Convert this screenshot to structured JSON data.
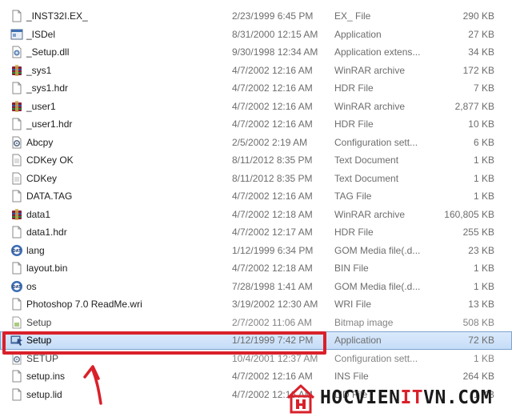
{
  "files": [
    {
      "name": "_INST32I.EX_",
      "date": "2/23/1999 6:45 PM",
      "type": "EX_ File",
      "size": "290 KB",
      "icon": "blank-file-icon"
    },
    {
      "name": "_ISDel",
      "date": "8/31/2000 12:15 AM",
      "type": "Application",
      "size": "27 KB",
      "icon": "application-icon"
    },
    {
      "name": "_Setup.dll",
      "date": "9/30/1998 12:34 AM",
      "type": "Application extens...",
      "size": "34 KB",
      "icon": "dll-icon"
    },
    {
      "name": "_sys1",
      "date": "4/7/2002 12:16 AM",
      "type": "WinRAR archive",
      "size": "172 KB",
      "icon": "winrar-icon"
    },
    {
      "name": "_sys1.hdr",
      "date": "4/7/2002 12:16 AM",
      "type": "HDR File",
      "size": "7 KB",
      "icon": "blank-file-icon"
    },
    {
      "name": "_user1",
      "date": "4/7/2002 12:16 AM",
      "type": "WinRAR archive",
      "size": "2,877 KB",
      "icon": "winrar-icon"
    },
    {
      "name": "_user1.hdr",
      "date": "4/7/2002 12:16 AM",
      "type": "HDR File",
      "size": "10 KB",
      "icon": "blank-file-icon"
    },
    {
      "name": "Abcpy",
      "date": "2/5/2002 2:19 AM",
      "type": "Configuration sett...",
      "size": "6 KB",
      "icon": "config-icon"
    },
    {
      "name": "CDKey OK",
      "date": "8/11/2012 8:35 PM",
      "type": "Text Document",
      "size": "1 KB",
      "icon": "text-file-icon"
    },
    {
      "name": "CDKey",
      "date": "8/11/2012 8:35 PM",
      "type": "Text Document",
      "size": "1 KB",
      "icon": "text-file-icon"
    },
    {
      "name": "DATA.TAG",
      "date": "4/7/2002 12:16 AM",
      "type": "TAG File",
      "size": "1 KB",
      "icon": "blank-file-icon"
    },
    {
      "name": "data1",
      "date": "4/7/2002 12:18 AM",
      "type": "WinRAR archive",
      "size": "160,805 KB",
      "icon": "winrar-icon"
    },
    {
      "name": "data1.hdr",
      "date": "4/7/2002 12:17 AM",
      "type": "HDR File",
      "size": "255 KB",
      "icon": "blank-file-icon"
    },
    {
      "name": "lang",
      "date": "1/12/1999 6:34 PM",
      "type": "GOM Media file(.d...",
      "size": "23 KB",
      "icon": "gom-media-icon"
    },
    {
      "name": "layout.bin",
      "date": "4/7/2002 12:18 AM",
      "type": "BIN File",
      "size": "1 KB",
      "icon": "blank-file-icon"
    },
    {
      "name": "os",
      "date": "7/28/1998 1:41 AM",
      "type": "GOM Media file(.d...",
      "size": "1 KB",
      "icon": "gom-media-icon"
    },
    {
      "name": "Photoshop 7.0 ReadMe.wri",
      "date": "3/19/2002 12:30 AM",
      "type": "WRI File",
      "size": "13 KB",
      "icon": "blank-file-icon"
    },
    {
      "name": "Setup",
      "date": "2/7/2002 11:06 AM",
      "type": "Bitmap image",
      "size": "508 KB",
      "icon": "bitmap-icon",
      "partial": true
    },
    {
      "name": "Setup",
      "date": "1/12/1999 7:42 PM",
      "type": "Application",
      "size": "72 KB",
      "icon": "setup-installer-icon",
      "selected": true
    },
    {
      "name": "SETUP",
      "date": "10/4/2001 12:37 AM",
      "type": "Configuration sett...",
      "size": "1 KB",
      "icon": "config-icon",
      "partial": true
    },
    {
      "name": "setup.ins",
      "date": "4/7/2002 12:16 AM",
      "type": "INS File",
      "size": "264 KB",
      "icon": "blank-file-icon"
    },
    {
      "name": "setup.lid",
      "date": "4/7/2002 12:16 AM",
      "type": "LID File",
      "size": "1 KB",
      "icon": "blank-file-icon"
    }
  ],
  "annotation": {
    "highlight_color": "#d9202a",
    "arrow_color": "#d9202a"
  },
  "watermark": {
    "text_prefix": "HOCVIEN",
    "text_accent": "IT",
    "text_suffix": "VN.COM",
    "logo": "hocvienitvn-logo",
    "accent_color": "#d9202a"
  },
  "colors": {
    "selection_fill": "#cfe3fa",
    "selection_border": "#7da2ce",
    "secondary_text": "#6d6d6d"
  }
}
